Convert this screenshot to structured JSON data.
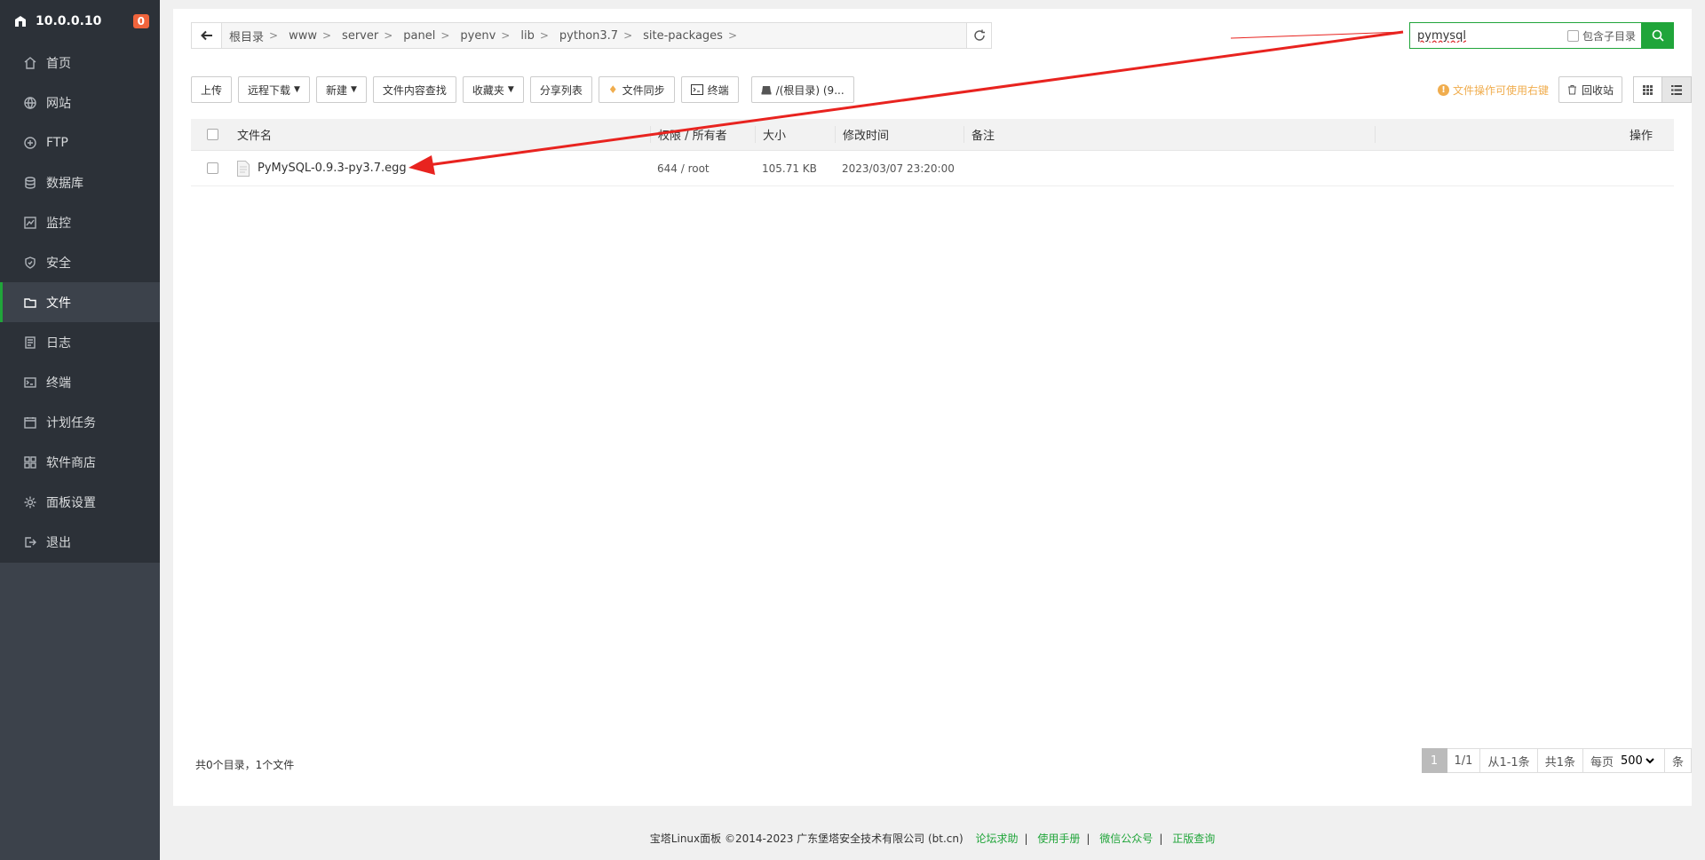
{
  "sidebar": {
    "server_ip": "10.0.0.10",
    "notice_count": "0",
    "items": [
      {
        "label": "首页",
        "icon": "home-icon"
      },
      {
        "label": "网站",
        "icon": "globe-icon"
      },
      {
        "label": "FTP",
        "icon": "ftp-icon"
      },
      {
        "label": "数据库",
        "icon": "database-icon"
      },
      {
        "label": "监控",
        "icon": "monitor-icon"
      },
      {
        "label": "安全",
        "icon": "shield-icon"
      },
      {
        "label": "文件",
        "icon": "folder-icon"
      },
      {
        "label": "日志",
        "icon": "log-icon"
      },
      {
        "label": "终端",
        "icon": "terminal-icon"
      },
      {
        "label": "计划任务",
        "icon": "calendar-icon"
      },
      {
        "label": "软件商店",
        "icon": "apps-icon"
      },
      {
        "label": "面板设置",
        "icon": "gear-icon"
      },
      {
        "label": "退出",
        "icon": "logout-icon"
      }
    ],
    "active_index": 6
  },
  "path": {
    "crumbs": [
      "根目录",
      "www",
      "server",
      "panel",
      "pyenv",
      "lib",
      "python3.7",
      "site-packages"
    ]
  },
  "search": {
    "value": "pymysql",
    "subdir_label": "包含子目录"
  },
  "toolbar": {
    "upload": "上传",
    "remote_download": "远程下载",
    "new": "新建",
    "content_search": "文件内容查找",
    "favorites": "收藏夹",
    "share_list": "分享列表",
    "file_sync": "文件同步",
    "terminal": "终端",
    "disk": "/(根目录) (9..."
  },
  "tool_right": {
    "tip": "文件操作可使用右键",
    "recycle": "回收站"
  },
  "table": {
    "headers": {
      "name": "文件名",
      "perm": "权限 / 所有者",
      "size": "大小",
      "mtime": "修改时间",
      "note": "备注",
      "ops": "操作"
    },
    "rows": [
      {
        "name": "PyMySQL-0.9.3-py3.7.egg",
        "perm": "644 / root",
        "size": "105.71 KB",
        "mtime": "2023/03/07 23:20:00",
        "note": ""
      }
    ]
  },
  "summary": "共0个目录，1个文件",
  "pager": {
    "current": "1",
    "pages": "1/1",
    "range": "从1-1条",
    "total": "共1条",
    "per_page_label": "每页",
    "per_page": "500",
    "unit": "条"
  },
  "footer": {
    "copyright": "宝塔Linux面板 ©2014-2023 广东堡塔安全技术有限公司 (bt.cn)",
    "links": [
      "论坛求助",
      "使用手册",
      "微信公众号",
      "正版查询"
    ]
  },
  "colors": {
    "accent": "#20a53a",
    "sidebar_bg": "#2c3138",
    "annotation_arrow": "#e8231f",
    "warning": "#f0ad4e"
  }
}
